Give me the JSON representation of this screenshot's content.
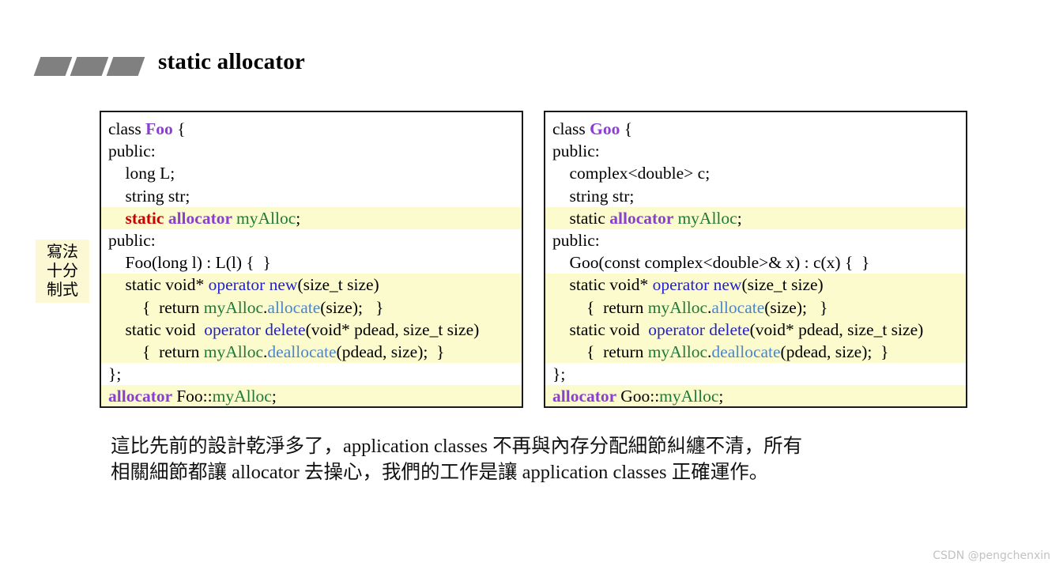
{
  "slide": {
    "title": "static allocator",
    "bullet_icon": "three-parallelograms-icon",
    "marks": [
      "mark-1",
      "mark-2",
      "mark-3"
    ]
  },
  "side_note": {
    "lines": [
      "寫法",
      "十分",
      "制式"
    ],
    "background_color": "#fcf8d4"
  },
  "colors": {
    "highlight": "#fcfbce",
    "type_purple": "#8a3fd1",
    "static_red": "#cc0000",
    "identifier_green": "#1f7a39",
    "operator_blue": "#2222c8",
    "method_blue": "#4a86c8",
    "border": "#1a1a1a",
    "mark_gray": "#808080",
    "watermark_gray": "#c2c2c2"
  },
  "code_left": {
    "title": "class Foo",
    "lines": [
      {
        "highlight": false,
        "indent": 0,
        "tokens": [
          {
            "t": "class ",
            "c": "plain"
          },
          {
            "t": "Foo",
            "c": "type"
          },
          {
            "t": " {",
            "c": "plain"
          }
        ]
      },
      {
        "highlight": false,
        "indent": 0,
        "tokens": [
          {
            "t": "public:",
            "c": "plain"
          }
        ]
      },
      {
        "highlight": false,
        "indent": 1,
        "tokens": [
          {
            "t": "long L;",
            "c": "plain"
          }
        ]
      },
      {
        "highlight": false,
        "indent": 1,
        "tokens": [
          {
            "t": "string str;",
            "c": "plain"
          }
        ]
      },
      {
        "highlight": true,
        "indent": 1,
        "tokens": [
          {
            "t": "static ",
            "c": "kw-red"
          },
          {
            "t": "allocator ",
            "c": "type"
          },
          {
            "t": "myAlloc",
            "c": "green"
          },
          {
            "t": ";",
            "c": "plain"
          }
        ]
      },
      {
        "highlight": false,
        "indent": 0,
        "tokens": [
          {
            "t": "public:",
            "c": "plain"
          }
        ]
      },
      {
        "highlight": false,
        "indent": 1,
        "tokens": [
          {
            "t": "Foo(long l) : L(l) {  }",
            "c": "plain"
          }
        ]
      },
      {
        "highlight": true,
        "indent": 1,
        "tokens": [
          {
            "t": "static void* ",
            "c": "plain"
          },
          {
            "t": "operator new",
            "c": "blue"
          },
          {
            "t": "(size_t size)",
            "c": "plain"
          }
        ]
      },
      {
        "highlight": true,
        "indent": 2,
        "tokens": [
          {
            "t": "{  return ",
            "c": "plain"
          },
          {
            "t": "myAlloc",
            "c": "green"
          },
          {
            "t": ".",
            "c": "plain"
          },
          {
            "t": "allocate",
            "c": "blue2"
          },
          {
            "t": "(size);   }",
            "c": "plain"
          }
        ]
      },
      {
        "highlight": true,
        "indent": 1,
        "tokens": [
          {
            "t": "static void  ",
            "c": "plain"
          },
          {
            "t": "operator delete",
            "c": "blue"
          },
          {
            "t": "(void* pdead, size_t size)",
            "c": "plain"
          }
        ]
      },
      {
        "highlight": true,
        "indent": 2,
        "tokens": [
          {
            "t": "{  return ",
            "c": "plain"
          },
          {
            "t": "myAlloc",
            "c": "green"
          },
          {
            "t": ".",
            "c": "plain"
          },
          {
            "t": "deallocate",
            "c": "blue2"
          },
          {
            "t": "(pdead, size);  }",
            "c": "plain"
          }
        ]
      },
      {
        "highlight": false,
        "indent": 0,
        "tokens": [
          {
            "t": "};",
            "c": "plain"
          }
        ]
      },
      {
        "highlight": true,
        "indent": 0,
        "tokens": [
          {
            "t": "allocator ",
            "c": "type"
          },
          {
            "t": "Foo::",
            "c": "plain"
          },
          {
            "t": "myAlloc",
            "c": "green"
          },
          {
            "t": ";",
            "c": "plain"
          }
        ]
      }
    ]
  },
  "code_right": {
    "title": "class Goo",
    "lines": [
      {
        "highlight": false,
        "indent": 0,
        "tokens": [
          {
            "t": "class ",
            "c": "plain"
          },
          {
            "t": "Goo",
            "c": "type"
          },
          {
            "t": " {",
            "c": "plain"
          }
        ]
      },
      {
        "highlight": false,
        "indent": 0,
        "tokens": [
          {
            "t": "public:",
            "c": "plain"
          }
        ]
      },
      {
        "highlight": false,
        "indent": 1,
        "tokens": [
          {
            "t": "complex<double> c;",
            "c": "plain"
          }
        ]
      },
      {
        "highlight": false,
        "indent": 1,
        "tokens": [
          {
            "t": "string str;",
            "c": "plain"
          }
        ]
      },
      {
        "highlight": true,
        "indent": 1,
        "tokens": [
          {
            "t": "static ",
            "c": "plain"
          },
          {
            "t": "allocator ",
            "c": "type"
          },
          {
            "t": "myAlloc",
            "c": "green"
          },
          {
            "t": ";",
            "c": "plain"
          }
        ]
      },
      {
        "highlight": false,
        "indent": 0,
        "tokens": [
          {
            "t": "public:",
            "c": "plain"
          }
        ]
      },
      {
        "highlight": false,
        "indent": 1,
        "tokens": [
          {
            "t": "Goo(const complex<double>& x) : c(x) {  }",
            "c": "plain"
          }
        ]
      },
      {
        "highlight": true,
        "indent": 1,
        "tokens": [
          {
            "t": "static void* ",
            "c": "plain"
          },
          {
            "t": "operator new",
            "c": "blue"
          },
          {
            "t": "(size_t size)",
            "c": "plain"
          }
        ]
      },
      {
        "highlight": true,
        "indent": 2,
        "tokens": [
          {
            "t": "{  return ",
            "c": "plain"
          },
          {
            "t": "myAlloc",
            "c": "green"
          },
          {
            "t": ".",
            "c": "plain"
          },
          {
            "t": "allocate",
            "c": "blue2"
          },
          {
            "t": "(size);   }",
            "c": "plain"
          }
        ]
      },
      {
        "highlight": true,
        "indent": 1,
        "tokens": [
          {
            "t": "static void  ",
            "c": "plain"
          },
          {
            "t": "operator delete",
            "c": "blue"
          },
          {
            "t": "(void* pdead, size_t size)",
            "c": "plain"
          }
        ]
      },
      {
        "highlight": true,
        "indent": 2,
        "tokens": [
          {
            "t": "{  return ",
            "c": "plain"
          },
          {
            "t": "myAlloc",
            "c": "green"
          },
          {
            "t": ".",
            "c": "plain"
          },
          {
            "t": "deallocate",
            "c": "blue2"
          },
          {
            "t": "(pdead, size);  }",
            "c": "plain"
          }
        ]
      },
      {
        "highlight": false,
        "indent": 0,
        "tokens": [
          {
            "t": "};",
            "c": "plain"
          }
        ]
      },
      {
        "highlight": true,
        "indent": 0,
        "tokens": [
          {
            "t": "allocator ",
            "c": "type"
          },
          {
            "t": "Goo::",
            "c": "plain"
          },
          {
            "t": "myAlloc",
            "c": "green"
          },
          {
            "t": ";",
            "c": "plain"
          }
        ]
      }
    ]
  },
  "caption": {
    "line1": "這比先前的設計乾淨多了，application classes 不再與內存分配細節糾纏不清，所有",
    "line2": "相關細節都讓 allocator 去操心，我們的工作是讓 application classes 正確運作。"
  },
  "watermark": {
    "text": "CSDN @pengchenxin"
  }
}
